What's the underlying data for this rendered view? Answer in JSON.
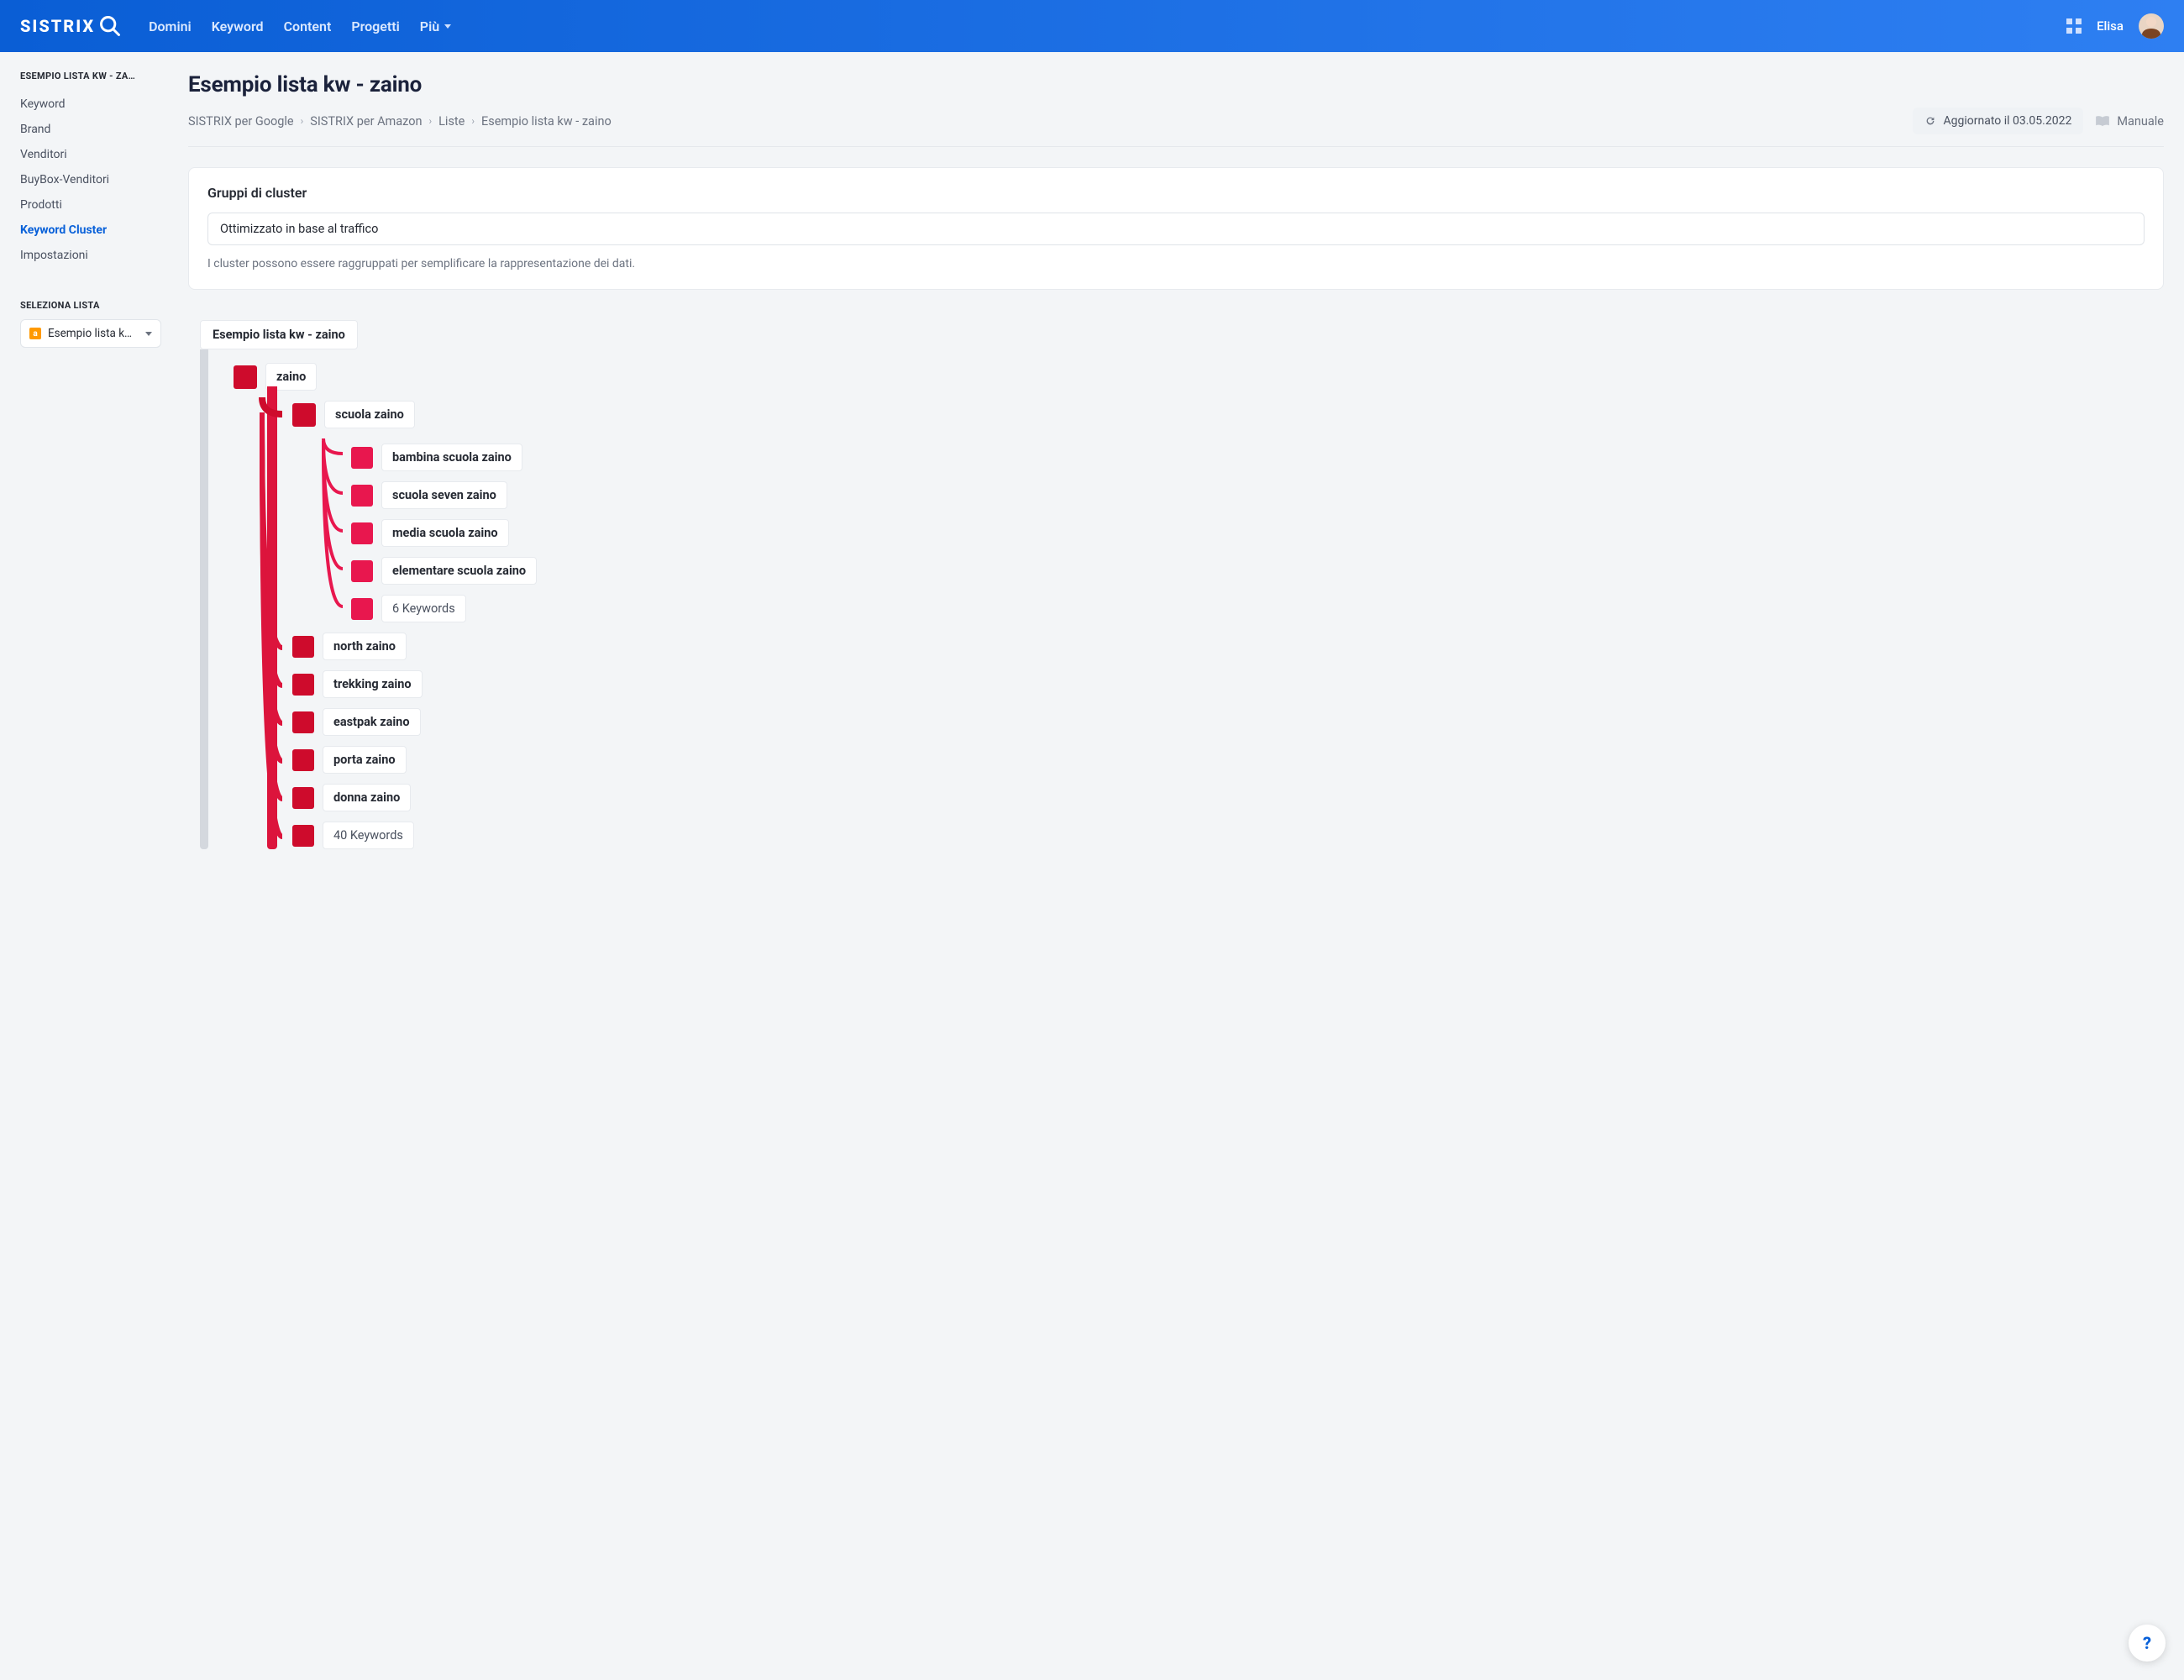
{
  "brand": "SISTRIX",
  "nav": {
    "items": [
      "Domini",
      "Keyword",
      "Content",
      "Progetti",
      "Più"
    ]
  },
  "user": {
    "name": "Elisa"
  },
  "sidebar": {
    "title": "ESEMPIO LISTA KW - ZA…",
    "items": [
      "Keyword",
      "Brand",
      "Venditori",
      "BuyBox-Venditori",
      "Prodotti",
      "Keyword Cluster",
      "Impostazioni"
    ],
    "activeIndex": 5,
    "selectHead": "SELEZIONA LISTA",
    "listIcon": "a",
    "listLabel": "Esempio lista kw…"
  },
  "page": {
    "title": "Esempio lista kw - zaino",
    "breadcrumbs": [
      "SISTRIX per Google",
      "SISTRIX per Amazon",
      "Liste",
      "Esempio lista kw - zaino"
    ],
    "updated": "Aggiornato il 03.05.2022",
    "manual": "Manuale"
  },
  "card": {
    "title": "Gruppi di cluster",
    "select": "Ottimizzato in base al traffico",
    "help": "I cluster possono essere raggruppati per semplificare la rappresentazione dei dati."
  },
  "tree": {
    "root": "Esempio lista kw - zaino",
    "zaino": "zaino",
    "scuola": "scuola zaino",
    "scuola_children": [
      "bambina scuola zaino",
      "scuola seven zaino",
      "media scuola zaino",
      "elementare scuola zaino"
    ],
    "scuola_more": "6 Keywords",
    "siblings": [
      "north zaino",
      "trekking zaino",
      "eastpak zaino",
      "porta zaino",
      "donna zaino"
    ],
    "more": "40 Keywords"
  },
  "fab": "?"
}
